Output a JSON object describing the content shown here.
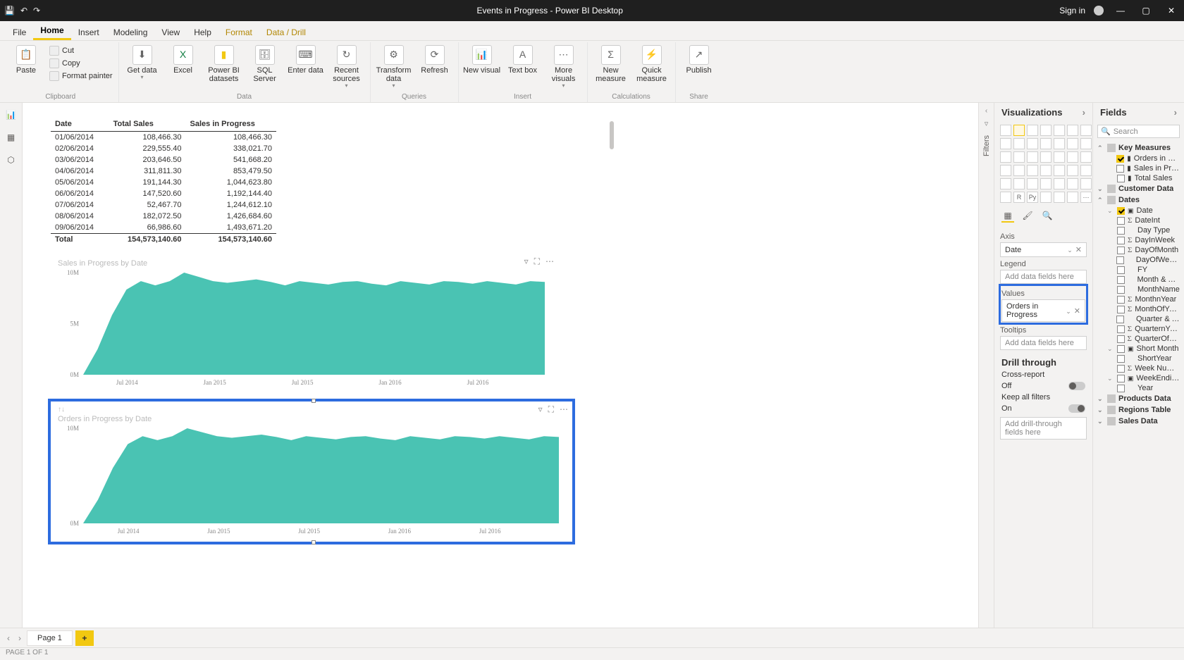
{
  "titlebar": {
    "title": "Events in Progress - Power BI Desktop",
    "signin": "Sign in"
  },
  "ribbon": {
    "file": "File",
    "tabs": [
      "Home",
      "Insert",
      "Modeling",
      "View",
      "Help",
      "Format",
      "Data / Drill"
    ],
    "active": "Home",
    "groups": {
      "clipboard": {
        "label": "Clipboard",
        "paste": "Paste",
        "cut": "Cut",
        "copy": "Copy",
        "fmt": "Format painter"
      },
      "data": {
        "label": "Data",
        "get": "Get data",
        "excel": "Excel",
        "pbi": "Power BI datasets",
        "sql": "SQL Server",
        "enter": "Enter data",
        "recent": "Recent sources"
      },
      "queries": {
        "label": "Queries",
        "transform": "Transform data",
        "refresh": "Refresh"
      },
      "insert": {
        "label": "Insert",
        "newvis": "New visual",
        "textbox": "Text box",
        "more": "More visuals"
      },
      "calc": {
        "label": "Calculations",
        "newmeasure": "New measure",
        "quick": "Quick measure"
      },
      "share": {
        "label": "Share",
        "publish": "Publish"
      }
    }
  },
  "leftbar": {
    "report": "Report",
    "data": "Data",
    "model": "Model"
  },
  "filters_label": "Filters",
  "panes": {
    "viz": {
      "title": "Visualizations",
      "wells": {
        "axis": {
          "label": "Axis",
          "value": "Date"
        },
        "legend": {
          "label": "Legend",
          "placeholder": "Add data fields here"
        },
        "values": {
          "label": "Values",
          "value": "Orders in Progress"
        },
        "tooltips": {
          "label": "Tooltips",
          "placeholder": "Add data fields here"
        }
      },
      "drill": {
        "title": "Drill through",
        "cross": "Cross-report",
        "cross_state": "Off",
        "keep": "Keep all filters",
        "keep_state": "On",
        "placeholder": "Add drill-through fields here"
      }
    },
    "fields": {
      "title": "Fields",
      "search": "Search",
      "tables": [
        {
          "name": "Key Measures",
          "expanded": true,
          "items": [
            {
              "name": "Orders in Pr…",
              "checked": true,
              "measure": true
            },
            {
              "name": "Sales in Pro…",
              "checked": false,
              "measure": true
            },
            {
              "name": "Total Sales",
              "checked": false,
              "measure": true
            }
          ]
        },
        {
          "name": "Customer Data",
          "expanded": false
        },
        {
          "name": "Dates",
          "expanded": true,
          "items": [
            {
              "name": "Date",
              "checked": true,
              "hier": true
            },
            {
              "name": "DateInt",
              "sigma": true
            },
            {
              "name": "Day Type"
            },
            {
              "name": "DayInWeek",
              "sigma": true
            },
            {
              "name": "DayOfMonth",
              "sigma": true
            },
            {
              "name": "DayOfWeek…"
            },
            {
              "name": "FY"
            },
            {
              "name": "Month & Y…"
            },
            {
              "name": "MonthName"
            },
            {
              "name": "MonthnYear",
              "sigma": true
            },
            {
              "name": "MonthOfYear",
              "sigma": true
            },
            {
              "name": "Quarter & Y…"
            },
            {
              "name": "QuarternYear",
              "sigma": true
            },
            {
              "name": "QuarterOfY…",
              "sigma": true
            },
            {
              "name": "Short Month",
              "hier": true
            },
            {
              "name": "ShortYear"
            },
            {
              "name": "Week Num…",
              "sigma": true
            },
            {
              "name": "WeekEnding",
              "hier": true
            },
            {
              "name": "Year"
            }
          ]
        },
        {
          "name": "Products Data",
          "expanded": false
        },
        {
          "name": "Regions Table",
          "expanded": false
        },
        {
          "name": "Sales Data",
          "expanded": false
        }
      ]
    }
  },
  "table_visual": {
    "columns": [
      "Date",
      "Total Sales",
      "Sales in Progress"
    ],
    "rows": [
      [
        "01/06/2014",
        "108,466.30",
        "108,466.30"
      ],
      [
        "02/06/2014",
        "229,555.40",
        "338,021.70"
      ],
      [
        "03/06/2014",
        "203,646.50",
        "541,668.20"
      ],
      [
        "04/06/2014",
        "311,811.30",
        "853,479.50"
      ],
      [
        "05/06/2014",
        "191,144.30",
        "1,044,623.80"
      ],
      [
        "06/06/2014",
        "147,520.60",
        "1,192,144.40"
      ],
      [
        "07/06/2014",
        "52,467.70",
        "1,244,612.10"
      ],
      [
        "08/06/2014",
        "182,072.50",
        "1,426,684.60"
      ],
      [
        "09/06/2014",
        "66,986.60",
        "1,493,671.20"
      ]
    ],
    "total": [
      "Total",
      "154,573,140.60",
      "154,573,140.60"
    ]
  },
  "chart_data": [
    {
      "type": "area",
      "title": "Sales in Progress by Date",
      "ylabel": "",
      "x_ticks": [
        "Jul 2014",
        "Jan 2015",
        "Jul 2015",
        "Jan 2016",
        "Jul 2016"
      ],
      "y_ticks": [
        "0M",
        "5M",
        "10M"
      ],
      "ylim": [
        0,
        12000000
      ],
      "series": [
        {
          "name": "Sales in Progress",
          "color": "#2ab8a6",
          "values": [
            0,
            3,
            7,
            10,
            11,
            10.5,
            11,
            12,
            11.5,
            11,
            10.8,
            11,
            11.2,
            10.9,
            10.5,
            11,
            10.8,
            10.6,
            10.9,
            11,
            10.7,
            10.5,
            11,
            10.8,
            10.6,
            11,
            10.9,
            10.7,
            11,
            10.8,
            10.6,
            11,
            10.9
          ]
        }
      ]
    },
    {
      "type": "area",
      "title": "Orders in Progress by Date",
      "ylabel": "",
      "x_ticks": [
        "Jul 2014",
        "Jan 2015",
        "Jul 2015",
        "Jan 2016",
        "Jul 2016"
      ],
      "y_ticks": [
        "0M",
        "10M"
      ],
      "ylim": [
        0,
        12000000
      ],
      "series": [
        {
          "name": "Orders in Progress",
          "color": "#2ab8a6",
          "values": [
            0,
            3,
            7,
            10,
            11,
            10.5,
            11,
            12,
            11.5,
            11,
            10.8,
            11,
            11.2,
            10.9,
            10.5,
            11,
            10.8,
            10.6,
            10.9,
            11,
            10.7,
            10.5,
            11,
            10.8,
            10.6,
            11,
            10.9,
            10.7,
            11,
            10.8,
            10.6,
            11,
            10.9
          ]
        }
      ]
    }
  ],
  "pagetabs": {
    "page": "Page 1"
  },
  "status": "PAGE 1 OF 1"
}
